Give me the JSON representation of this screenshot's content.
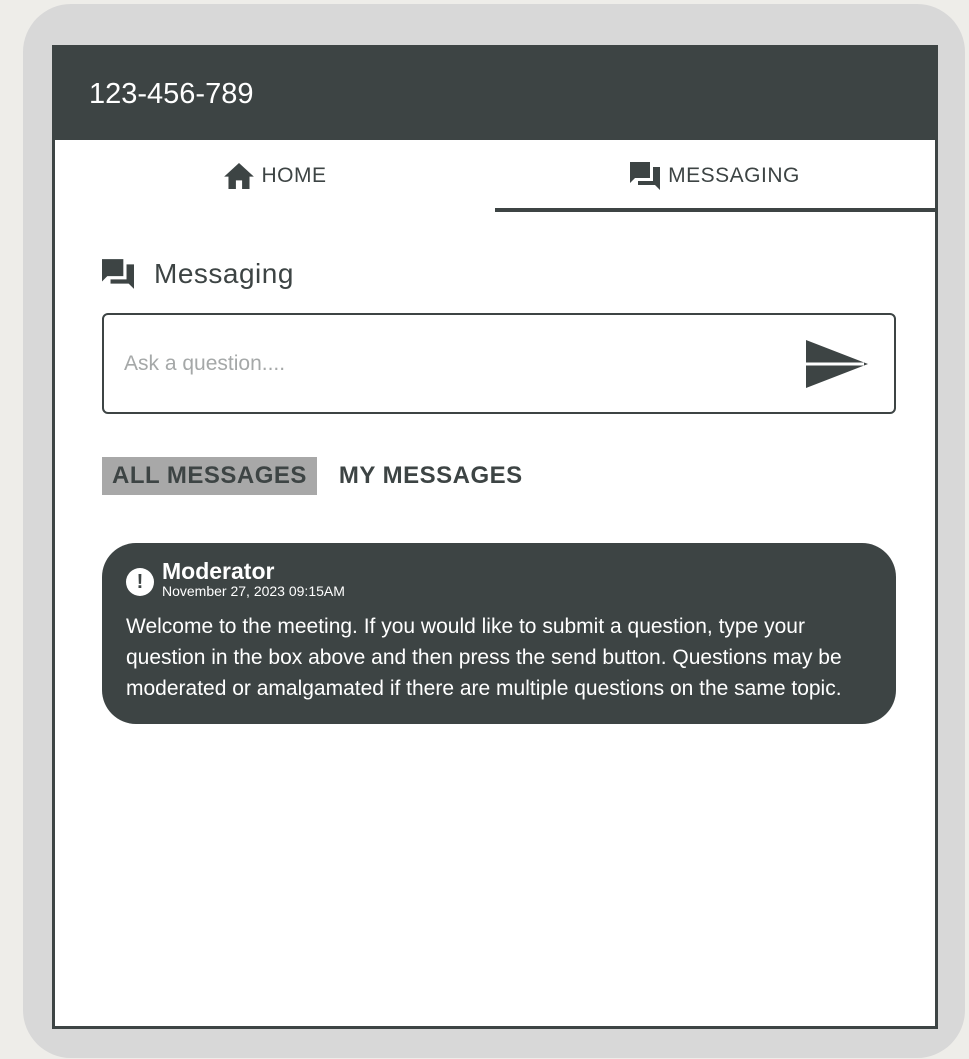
{
  "header": {
    "phone": "123-456-789"
  },
  "tabs": [
    {
      "label": "HOME",
      "icon": "home-icon",
      "active": false
    },
    {
      "label": "MESSAGING",
      "icon": "chat-icon",
      "active": true
    }
  ],
  "section": {
    "title": "Messaging",
    "icon": "chat-icon"
  },
  "question_input": {
    "placeholder": "Ask a question....",
    "value": ""
  },
  "filters": [
    {
      "label": "ALL MESSAGES",
      "active": true
    },
    {
      "label": "MY MESSAGES",
      "active": false
    }
  ],
  "messages": [
    {
      "author": "Moderator",
      "date": "November 27, 2023 09:15AM",
      "body": "Welcome to the meeting. If you would like to submit a question, type your question in the box above and then press the send button. Questions may be moderated or amalgamated if there are multiple questions on the same topic.",
      "icon": "alert-icon",
      "icon_glyph": "!"
    }
  ],
  "colors": {
    "primary": "#3d4444",
    "active_filter_bg": "#a8a8a8",
    "device_frame": "#d8d8d8",
    "page_bg": "#eeede9"
  }
}
